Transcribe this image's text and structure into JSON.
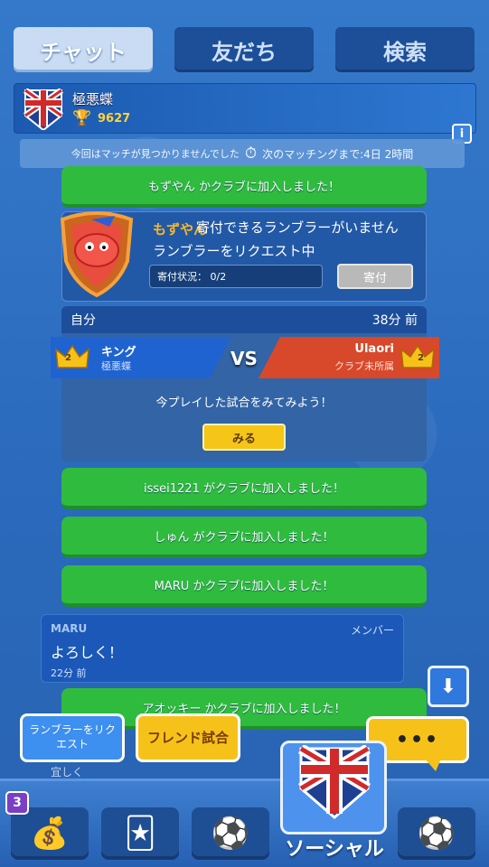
{
  "tabs": [
    {
      "label": "チャット",
      "active": true
    },
    {
      "label": "友だち",
      "active": false
    },
    {
      "label": "検索",
      "active": false
    }
  ],
  "club": {
    "name": "極悪蝶",
    "trophies": "9627",
    "info_icon": "i"
  },
  "matching": {
    "text": "今回はマッチが見つかりませんでした",
    "next": "次のマッチングまで:4日 2時間"
  },
  "messages": {
    "sys1": "もずやん かクラブに加入しました！",
    "donate": {
      "who": "もずやん",
      "line1": "寄付できるランブラーがいません",
      "line2": "ランブラーをリクエスト中",
      "status": "寄付状況： 0/2",
      "give_label": "寄付"
    },
    "battle": {
      "author": "自分",
      "time": "38分 前",
      "p1_name": "キング",
      "p1_club": "極悪蝶",
      "p1_rank": "2",
      "p2_name": "Ulaori",
      "p2_club": "クラブ未所属",
      "p2_rank": "2",
      "vs": "VS",
      "prompt": "今プレイした試合をみてみよう！",
      "watch_label": "みる"
    },
    "sys2": "issei1221 がクラブに加入しました！",
    "sys3": "しゅん がクラブに加入しました！",
    "sys4": "MARU かクラブに加入しました！",
    "chat": {
      "sender": "MARU",
      "role": "メンバー",
      "text": "よろしく！",
      "time": "22分 前"
    },
    "sys5": "アオッキー かクラブに加入しました！",
    "peek": "宜しく"
  },
  "actions": {
    "request_label": "ランブラーをリクエスト",
    "friend_label": "フレンド試合",
    "more_label": "•••"
  },
  "nav": {
    "badge": "3",
    "social_label": "ソーシャル"
  },
  "colors": {
    "system_msg": "#2fbb3e",
    "accent_yellow": "#f6c21a",
    "blue_team": "#1f63d1",
    "red_team": "#d8482a"
  }
}
